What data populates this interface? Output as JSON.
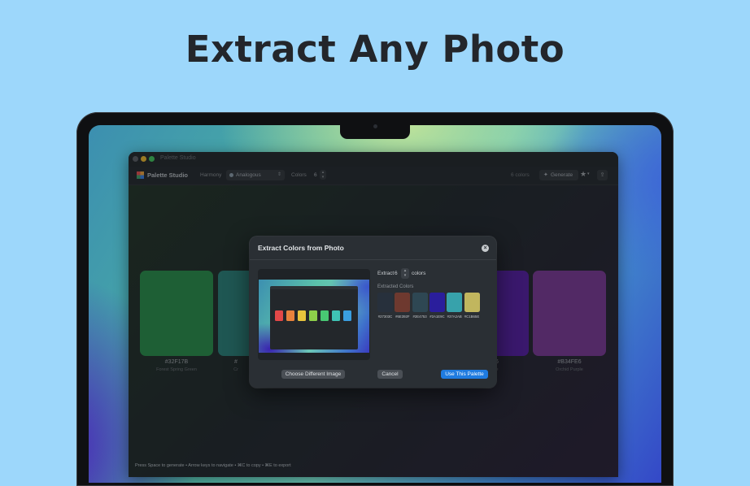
{
  "headline": "Extract Any Photo",
  "window": {
    "title": "Palette Studio",
    "app_name": "Palette Studio",
    "harmony_label": "Harmony",
    "harmony_value": "Analogous",
    "colors_label": "Colors",
    "colors_value": "6",
    "count_label": "6 colors",
    "generate_label": "Generate",
    "footer_hint": "Press Space to generate • Arrow keys to navigate • ⌘C to copy • ⌘E to export"
  },
  "swatches": [
    {
      "hex": "#32F17B",
      "name": "Forest Spring Green",
      "color": "#2a8c4a"
    },
    {
      "hex": "#",
      "name": "Cr",
      "color": "#2b8078"
    },
    {
      "hex": "#",
      "name": "",
      "color": "#5520a0"
    },
    {
      "hex": "#B34FE6",
      "name": "Orchid Purple",
      "color": "#7a3a94"
    }
  ],
  "swatch_partials": {
    "right_hex": "6",
    "right_name": "e"
  },
  "dialog": {
    "title": "Extract Colors from Photo",
    "extract_label": "Extract",
    "extract_value": "6",
    "colors_word": "colors",
    "extracted_label": "Extracted Colors",
    "colors": [
      {
        "hex": "#27303C",
        "color": "#27303c"
      },
      {
        "hex": "#6E392F",
        "color": "#6e392f"
      },
      {
        "hex": "#2E4753",
        "color": "#2e4753"
      },
      {
        "hex": "#2A1E9C",
        "color": "#2a1e9c"
      },
      {
        "hex": "#37A2AB",
        "color": "#37a2ab"
      },
      {
        "hex": "#C1B65E",
        "color": "#c1b65e"
      }
    ],
    "choose_button": "Choose Different Image",
    "cancel_button": "Cancel",
    "use_button": "Use This Palette"
  },
  "preview_palette": [
    "#e34848",
    "#e8823c",
    "#e8c43c",
    "#8ed04a",
    "#48c873",
    "#3fc4b5",
    "#3a9ee0"
  ],
  "icons": {
    "close": "close-icon",
    "star": "star-icon",
    "share": "share-icon",
    "generate": "sparkle-icon"
  }
}
